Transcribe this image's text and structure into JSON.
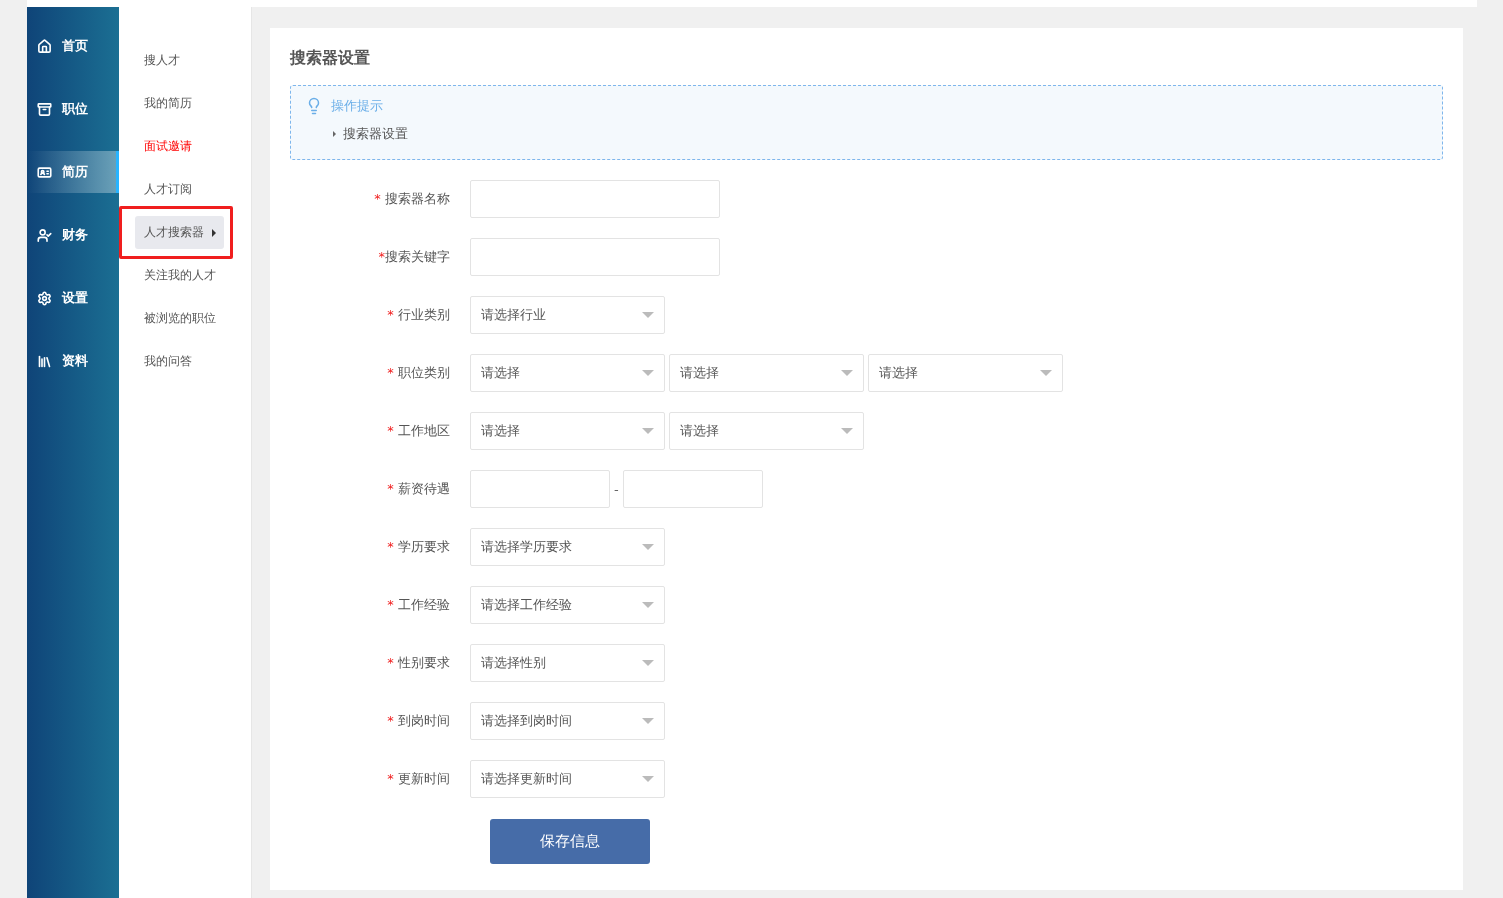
{
  "nav": [
    {
      "label": "首页",
      "kind": "home",
      "selected": false
    },
    {
      "label": "职位",
      "kind": "job",
      "selected": false
    },
    {
      "label": "简历",
      "kind": "resume",
      "selected": true
    },
    {
      "label": "财务",
      "kind": "finance",
      "selected": false
    },
    {
      "label": "设置",
      "kind": "settings",
      "selected": false
    },
    {
      "label": "资料",
      "kind": "profile",
      "selected": false
    }
  ],
  "submenu": [
    {
      "label": "搜人才",
      "selected": false,
      "alert": false,
      "marked": false
    },
    {
      "label": "我的简历",
      "selected": false,
      "alert": false,
      "marked": false
    },
    {
      "label": "面试邀请",
      "selected": false,
      "alert": true,
      "marked": false
    },
    {
      "label": "人才订阅",
      "selected": false,
      "alert": false,
      "marked": false
    },
    {
      "label": "人才搜索器",
      "selected": true,
      "alert": false,
      "marked": true
    },
    {
      "label": "关注我的人才",
      "selected": false,
      "alert": false,
      "marked": false
    },
    {
      "label": "被浏览的职位",
      "selected": false,
      "alert": false,
      "marked": false
    },
    {
      "label": "我的问答",
      "selected": false,
      "alert": false,
      "marked": false
    }
  ],
  "page_title": "搜索器设置",
  "tip": {
    "title": "操作提示",
    "items": [
      "搜索器设置"
    ]
  },
  "form": [
    {
      "kind": "text",
      "mark": "* ",
      "label": "搜索器名称"
    },
    {
      "kind": "text",
      "mark": "*",
      "label": "搜索关键字"
    },
    {
      "kind": "select",
      "mark": "* ",
      "label": "行业类别",
      "options": [
        "请选择行业"
      ]
    },
    {
      "kind": "select",
      "mark": "* ",
      "label": "职位类别",
      "options": [
        "请选择",
        "请选择",
        "请选择"
      ]
    },
    {
      "kind": "select",
      "mark": "* ",
      "label": "工作地区",
      "options": [
        "请选择",
        "请选择"
      ]
    },
    {
      "kind": "range",
      "mark": "* ",
      "label": "薪资待遇",
      "separator": "-"
    },
    {
      "kind": "select",
      "mark": "* ",
      "label": "学历要求",
      "options": [
        "请选择学历要求"
      ]
    },
    {
      "kind": "select",
      "mark": "* ",
      "label": "工作经验",
      "options": [
        "请选择工作经验"
      ]
    },
    {
      "kind": "select",
      "mark": "* ",
      "label": "性别要求",
      "options": [
        "请选择性别"
      ]
    },
    {
      "kind": "select",
      "mark": "* ",
      "label": "到岗时间",
      "options": [
        "请选择到岗时间"
      ]
    },
    {
      "kind": "select",
      "mark": "* ",
      "label": "更新时间",
      "options": [
        "请选择更新时间"
      ]
    }
  ],
  "save_button": "保存信息"
}
